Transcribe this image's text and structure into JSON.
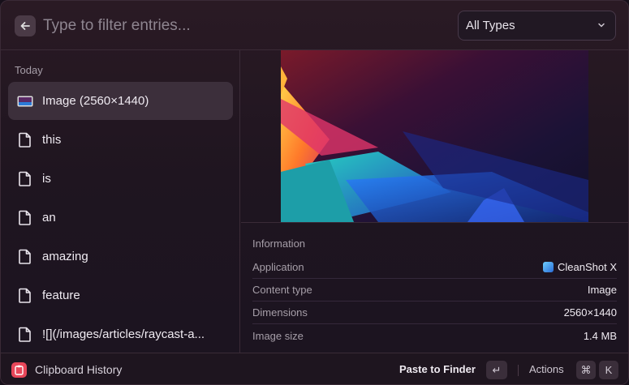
{
  "search": {
    "placeholder": "Type to filter entries..."
  },
  "filter": {
    "selected": "All Types"
  },
  "list": {
    "section": "Today",
    "items": [
      {
        "label": "Image (2560×1440)",
        "icon": "image-icon",
        "selected": true
      },
      {
        "label": "this",
        "icon": "text-file-icon"
      },
      {
        "label": "is",
        "icon": "text-file-icon"
      },
      {
        "label": "an",
        "icon": "text-file-icon"
      },
      {
        "label": "amazing",
        "icon": "text-file-icon"
      },
      {
        "label": "feature",
        "icon": "text-file-icon"
      },
      {
        "label": "![](/images/articles/raycast-a...",
        "icon": "text-file-icon"
      }
    ]
  },
  "info": {
    "title": "Information",
    "rows": [
      {
        "key": "Application",
        "value": "CleanShot X"
      },
      {
        "key": "Content type",
        "value": "Image"
      },
      {
        "key": "Dimensions",
        "value": "2560×1440"
      },
      {
        "key": "Image size",
        "value": "1.4 MB"
      }
    ]
  },
  "footer": {
    "app_name": "Clipboard History",
    "primary_action": "Paste to Finder",
    "primary_key": "↵",
    "actions_label": "Actions",
    "actions_key_1": "⌘",
    "actions_key_2": "K"
  },
  "colors": {
    "accent": "#e8475a",
    "selection": "#3c2f3b"
  }
}
